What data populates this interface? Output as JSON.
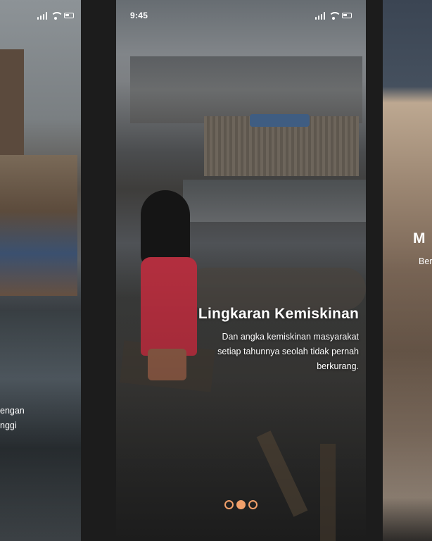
{
  "left_screen": {
    "peek_lines": [
      "engan",
      "nggi"
    ]
  },
  "center_screen": {
    "status": {
      "time": "9:45"
    },
    "title": "Lingkaran Kemiskinan",
    "description_lines": [
      "Dan angka kemiskinan masyarakat",
      "setiap tahunnya seolah tidak pernah",
      "berkurang."
    ],
    "page_indicator": {
      "count": 3,
      "active": 1
    }
  },
  "right_screen": {
    "peek_title": "M",
    "peek_desc": "Ber"
  },
  "colors": {
    "accent": "#f2a06a",
    "gutter": "#1c1c1c"
  },
  "icons": [
    "signal-icon",
    "wifi-icon",
    "battery-icon"
  ]
}
